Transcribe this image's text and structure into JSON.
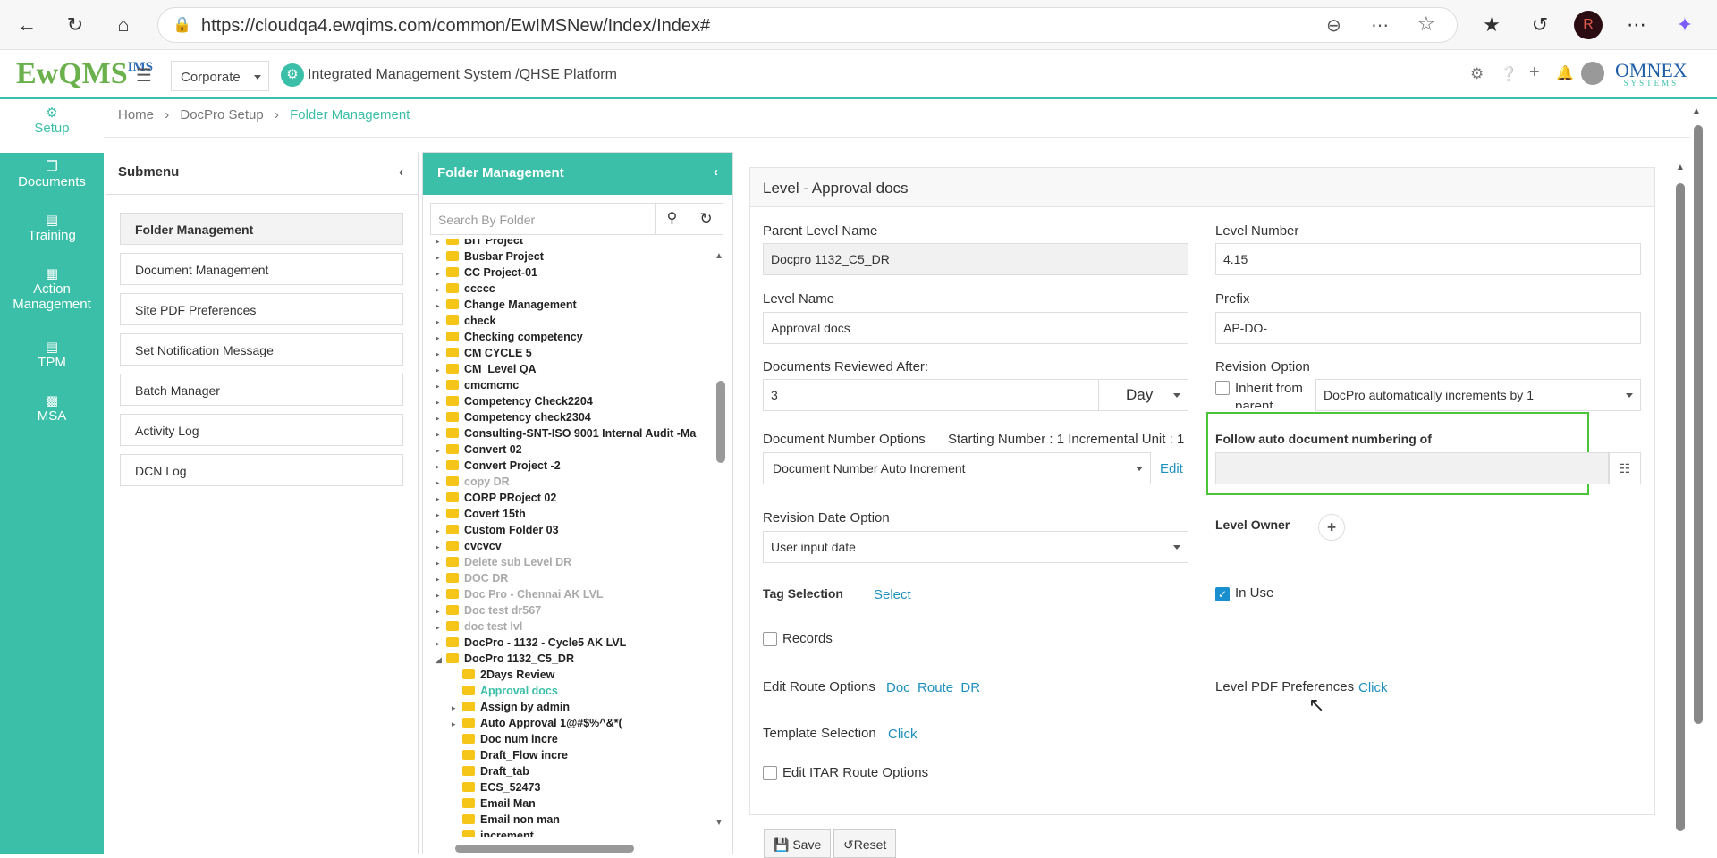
{
  "browser": {
    "url": "https://cloudqa4.ewqims.com/common/EwIMSNew/Index/Index#",
    "avatar_letter": "R"
  },
  "app": {
    "logo_text": "EwQMS",
    "logo_sup": "IMS",
    "company_select": "Corporate",
    "title": "Integrated Management System /QHSE Platform",
    "brand": "OMNEX",
    "brand_sub": "SYSTEMS"
  },
  "nav": [
    {
      "label": "Setup",
      "icon": "gear-icon"
    },
    {
      "label": "Documents",
      "icon": "documents-icon"
    },
    {
      "label": "Training",
      "icon": "training-icon"
    },
    {
      "label": "Action Management",
      "icon": "building-icon"
    },
    {
      "label": "TPM",
      "icon": "tpm-icon"
    },
    {
      "label": "MSA",
      "icon": "chart-icon"
    }
  ],
  "breadcrumb": {
    "home": "Home",
    "section": "DocPro Setup",
    "current": "Folder Management"
  },
  "submenu": {
    "title": "Submenu",
    "items": [
      "Folder Management",
      "Document Management",
      "Site PDF Preferences",
      "Set Notification Message",
      "Batch Manager",
      "Activity Log",
      "DCN Log"
    ]
  },
  "folder_panel": {
    "title": "Folder Management",
    "search_placeholder": "Search By Folder",
    "tree": [
      {
        "label": "BIT Project",
        "level": 0,
        "state": "normal"
      },
      {
        "label": "Busbar Project",
        "level": 0,
        "state": "normal"
      },
      {
        "label": "CC Project-01",
        "level": 0,
        "state": "normal"
      },
      {
        "label": "ccccc",
        "level": 0,
        "state": "normal"
      },
      {
        "label": "Change Management",
        "level": 0,
        "state": "normal"
      },
      {
        "label": "check",
        "level": 0,
        "state": "normal"
      },
      {
        "label": "Checking competency",
        "level": 0,
        "state": "normal"
      },
      {
        "label": "CM CYCLE 5",
        "level": 0,
        "state": "normal"
      },
      {
        "label": "CM_Level QA",
        "level": 0,
        "state": "normal"
      },
      {
        "label": "cmcmcmc",
        "level": 0,
        "state": "normal"
      },
      {
        "label": "Competency Check2204",
        "level": 0,
        "state": "normal"
      },
      {
        "label": "Competency check2304",
        "level": 0,
        "state": "normal"
      },
      {
        "label": "Consulting-SNT-ISO 9001 Internal Audit -Ma",
        "level": 0,
        "state": "normal"
      },
      {
        "label": "Convert 02",
        "level": 0,
        "state": "normal"
      },
      {
        "label": "Convert Project -2",
        "level": 0,
        "state": "normal"
      },
      {
        "label": "copy DR",
        "level": 0,
        "state": "dim"
      },
      {
        "label": "CORP PRoject 02",
        "level": 0,
        "state": "normal"
      },
      {
        "label": "Covert 15th",
        "level": 0,
        "state": "normal"
      },
      {
        "label": "Custom Folder 03",
        "level": 0,
        "state": "normal"
      },
      {
        "label": "cvcvcv",
        "level": 0,
        "state": "normal"
      },
      {
        "label": "Delete sub Level DR",
        "level": 0,
        "state": "dim"
      },
      {
        "label": "DOC DR",
        "level": 0,
        "state": "dim"
      },
      {
        "label": "Doc Pro - Chennai AK LVL",
        "level": 0,
        "state": "dim"
      },
      {
        "label": "Doc test dr567",
        "level": 0,
        "state": "dim"
      },
      {
        "label": "doc test lvl",
        "level": 0,
        "state": "dim"
      },
      {
        "label": "DocPro - 1132 - Cycle5 AK LVL",
        "level": 0,
        "state": "normal"
      },
      {
        "label": "DocPro 1132_C5_DR",
        "level": 0,
        "state": "expanded"
      },
      {
        "label": "2Days Review",
        "level": 1,
        "state": "normal"
      },
      {
        "label": "Approval docs",
        "level": 1,
        "state": "selected"
      },
      {
        "label": "Assign by admin",
        "level": 1,
        "state": "normal"
      },
      {
        "label": "Auto Approval 1@#$%^&*(",
        "level": 1,
        "state": "normal"
      },
      {
        "label": "Doc num incre",
        "level": 1,
        "state": "normal"
      },
      {
        "label": "Draft_Flow incre",
        "level": 1,
        "state": "normal"
      },
      {
        "label": "Draft_tab",
        "level": 1,
        "state": "normal"
      },
      {
        "label": "ECS_52473",
        "level": 1,
        "state": "normal"
      },
      {
        "label": "Email Man",
        "level": 1,
        "state": "normal"
      },
      {
        "label": "Email non man",
        "level": 1,
        "state": "normal"
      },
      {
        "label": "increment",
        "level": 1,
        "state": "normal"
      }
    ]
  },
  "form": {
    "title": "Level - Approval docs",
    "parent_level_name_label": "Parent Level Name",
    "parent_level_name": "Docpro 1132_C5_DR",
    "level_number_label": "Level Number",
    "level_number": "4.15",
    "level_name_label": "Level Name",
    "level_name": "Approval docs",
    "prefix_label": "Prefix",
    "prefix": "AP-DO-",
    "reviewed_after_label": "Documents Reviewed After:",
    "reviewed_after_value": "3",
    "reviewed_after_unit": "Day",
    "revision_option_label": "Revision Option",
    "inherit_label": "Inherit from parent",
    "revision_option_value": "DocPro automatically increments by 1",
    "doc_number_options_label": "Document Number Options",
    "starting_number_text": "Starting Number : 1 Incremental Unit : 1",
    "doc_number_option_value": "Document Number Auto Increment",
    "edit_link": "Edit",
    "follow_auto_label": "Follow auto document numbering of",
    "follow_auto_value": "",
    "revision_date_label": "Revision Date Option",
    "revision_date_value": "User input date",
    "level_owner_label": "Level Owner",
    "tag_selection_label": "Tag Selection",
    "tag_select_link": "Select",
    "in_use_label": "In Use",
    "records_label": "Records",
    "edit_route_label": "Edit Route Options",
    "edit_route_value": "Doc_Route_DR",
    "level_pdf_label": "Level PDF Preferences",
    "level_pdf_link": "Click",
    "template_label": "Template Selection",
    "template_link": "Click",
    "itar_label": "Edit ITAR Route Options",
    "save_label": "Save",
    "reset_label": "Reset"
  },
  "colors": {
    "accent": "#3bbfa8",
    "link": "#1f8fbf",
    "highlight_box": "#4cc43a"
  }
}
